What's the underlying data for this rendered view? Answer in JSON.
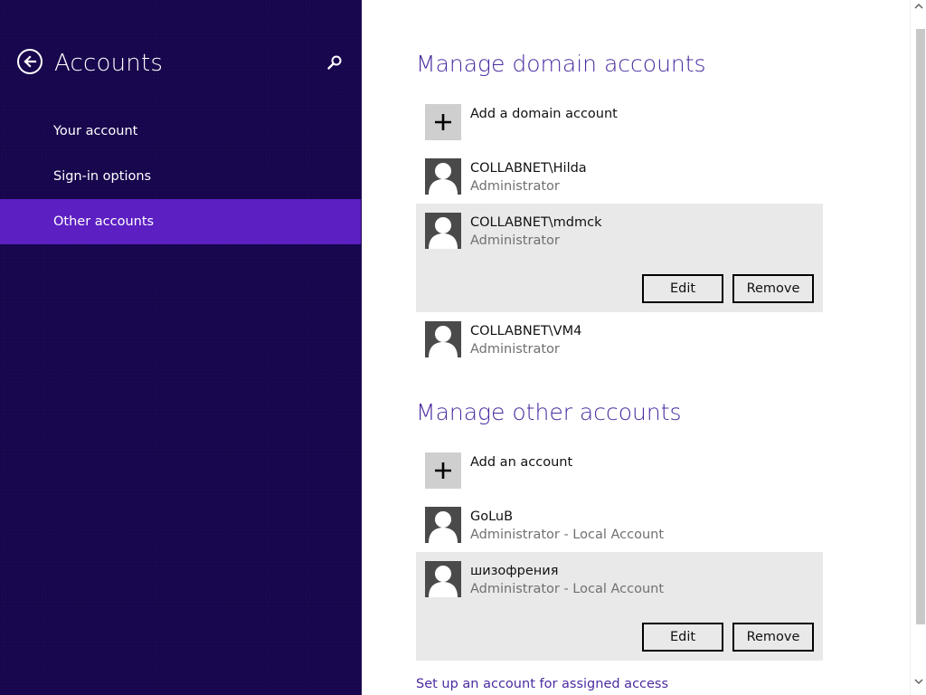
{
  "sidebar": {
    "title": "Accounts",
    "items": [
      {
        "label": "Your account"
      },
      {
        "label": "Sign-in options"
      },
      {
        "label": "Other accounts"
      }
    ]
  },
  "domain_section": {
    "title": "Manage domain accounts",
    "add_label": "Add a domain account",
    "accounts": [
      {
        "name": "COLLABNET\\Hilda",
        "role": "Administrator"
      },
      {
        "name": "COLLABNET\\mdmck",
        "role": "Administrator"
      },
      {
        "name": "COLLABNET\\VM4",
        "role": "Administrator"
      }
    ]
  },
  "other_section": {
    "title": "Manage other accounts",
    "add_label": "Add an account",
    "accounts": [
      {
        "name": "GoLuB",
        "role": "Administrator - Local Account"
      },
      {
        "name": "шизофрения",
        "role": "Administrator - Local Account"
      }
    ]
  },
  "buttons": {
    "edit": "Edit",
    "remove": "Remove"
  },
  "assigned_access_link": "Set up an account for assigned access",
  "colors": {
    "sidebar_bg": "#1a0752",
    "sidebar_active": "#5b1fc2",
    "accent_text": "#4a2ca0",
    "selected_bg": "#e9e9e9"
  }
}
